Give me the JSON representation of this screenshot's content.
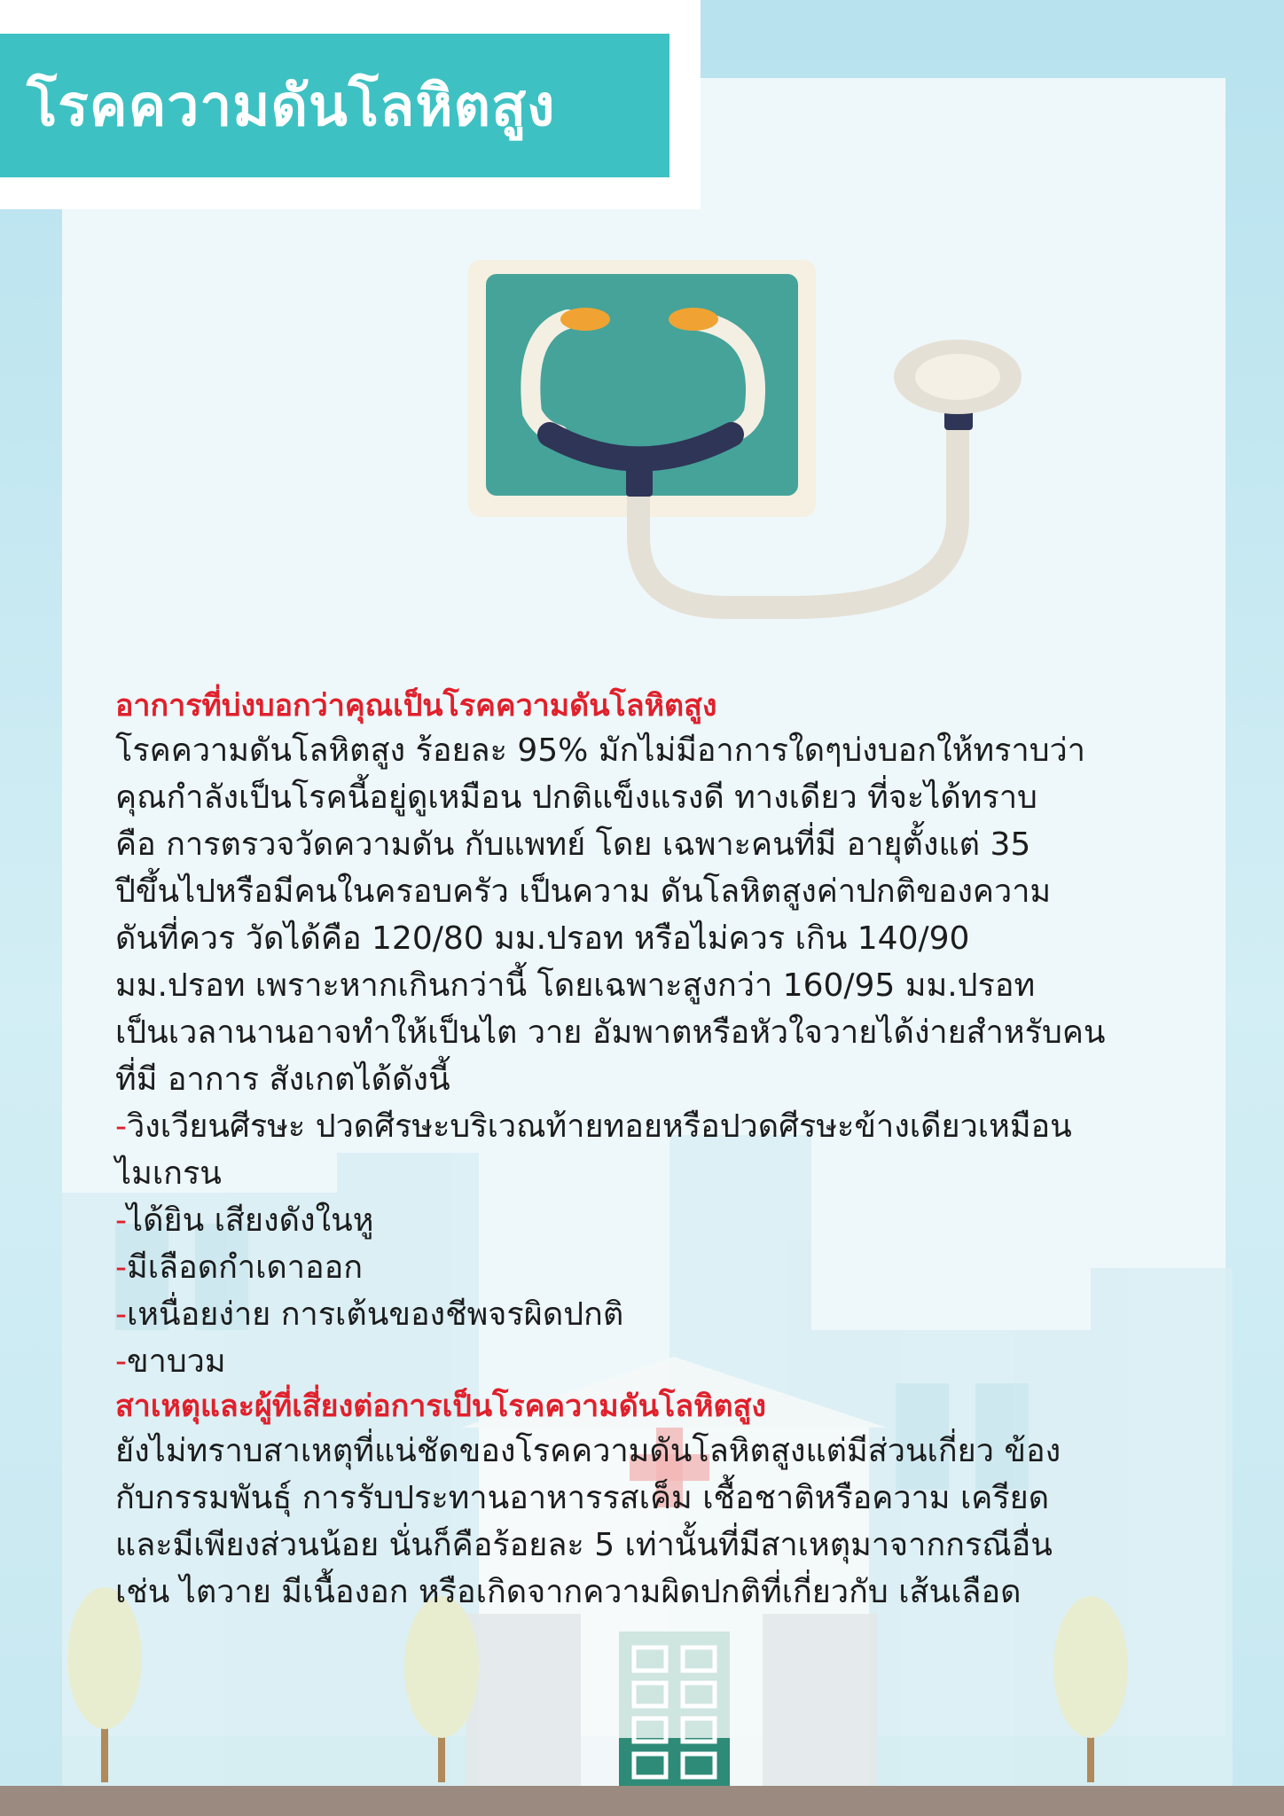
{
  "title": "โรคความดันโลหิตสูง",
  "section1": {
    "heading": "อาการที่บ่งบอกว่าคุณเป็นโรคความดันโลหิตสูง",
    "lines": [
      "โรคความดันโลหิตสูง ร้อยละ 95% มักไม่มีอาการใดๆบ่งบอกให้ทราบว่า",
      "คุณกำลังเป็นโรคนี้อยู่ดูเหมือน ปกติแข็งแรงดี  ทางเดียว ที่จะได้ทราบ",
      "คือ การตรวจวัดความดัน กับแพทย์ โดย เฉพาะคนที่มี อายุตั้งแต่ 35",
      "ปีขึ้นไปหรือมีคนในครอบครัว เป็นความ ดันโลหิตสูงค่าปกติของความ",
      "ดันที่ควร วัดได้คือ 120/80 มม.ปรอท หรือไม่ควร เกิน 140/90",
      "มม.ปรอท เพราะหากเกินกว่านี้ โดยเฉพาะสูงกว่า 160/95 มม.ปรอท",
      "เป็นเวลานานอาจทำให้เป็นไต วาย อัมพาตหรือหัวใจวายได้ง่ายสำหรับคน",
      "ที่มี อาการ สังเกตได้ดังนี้"
    ],
    "bullets": [
      {
        "dash": "-",
        "line1": "วิงเวียนศีรษะ ปวดศีรษะบริเวณท้ายทอยหรือปวดศีรษะข้างเดียวเหมือน",
        "line2": "ไมเกรน"
      },
      {
        "dash": "-",
        "line1": "ได้ยิน เสียงดังในหู",
        "line2": ""
      },
      {
        "dash": "-",
        "line1": "มีเลือดกำเดาออก",
        "line2": ""
      },
      {
        "dash": "-",
        "line1": "เหนื่อยง่าย การเต้นของชีพจรผิดปกติ",
        "line2": ""
      },
      {
        "dash": "-",
        "line1": "ขาบวม",
        "line2": ""
      }
    ]
  },
  "section2": {
    "heading": "สาเหตุและผู้ที่เสี่ยงต่อการเป็นโรคความดันโลหิตสูง",
    "lines": [
      "ยังไม่ทราบสาเหตุที่แน่ชัดของโรคความดันโลหิตสูงแต่มีส่วนเกี่ยว ข้อง",
      "กับกรรมพันธุ์ การรับประทานอาหารรสเค็ม เชื้อชาติหรือความ เครียด",
      "และมีเพียงส่วนน้อย นั่นก็คือร้อยละ 5 เท่านั้นที่มีสาเหตุมาจากกรณีอื่น",
      "เช่น ไตวาย มีเนื้องอก หรือเกิดจากความผิดปกติที่เกี่ยวกับ เส้นเลือด"
    ]
  },
  "colors": {
    "title_band": "#3ec1c3",
    "heading": "#e0202b",
    "body_text": "#1c1c1c",
    "background": "#eef8fb"
  },
  "icons": {
    "main": "stethoscope-icon",
    "background": "hospital-building-icon"
  }
}
